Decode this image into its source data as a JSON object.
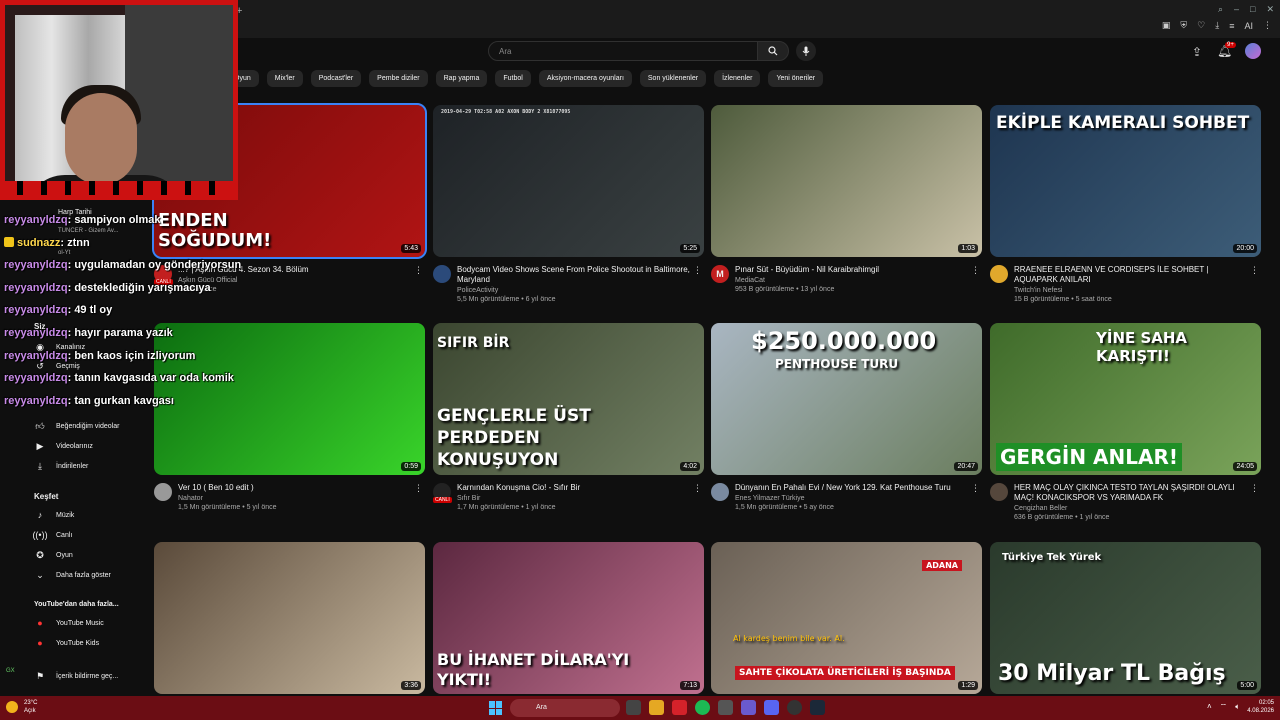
{
  "browser": {
    "new_tab": "+",
    "win_controls": [
      "–",
      "□",
      "✕"
    ],
    "tools": [
      "☰",
      "♡",
      "⭳",
      "☰"
    ],
    "ai_label": "AI"
  },
  "header": {
    "search_placeholder": "Ara",
    "notif_count": "9+"
  },
  "chips": [
    "Oyun",
    "Mix'ler",
    "Podcast'ler",
    "Pembe diziler",
    "Rap yapma",
    "Futbol",
    "Aksiyon-macera oyunları",
    "Son yüklenenler",
    "İzlenenler",
    "Yeni öneriler"
  ],
  "sidebar": {
    "subs": [
      {
        "label": "Harp Tarihi"
      },
      {
        "label": "TUNCER - Gizem Av..."
      },
      {
        "label": "ol-Yt"
      }
    ],
    "you_label": "Siz",
    "items_you": [
      {
        "label": "Kanalınız",
        "icon": "channel-icon"
      },
      {
        "label": "Geçmiş",
        "icon": "history-icon"
      }
    ],
    "items_lib": [
      {
        "label": "Beğendiğim videolar",
        "icon": "like-icon"
      },
      {
        "label": "Videolarınız",
        "icon": "video-icon"
      },
      {
        "label": "İndirilenler",
        "icon": "download-icon"
      }
    ],
    "explore_heading": "Keşfet",
    "explore": [
      {
        "label": "Müzik",
        "icon": "music-icon"
      },
      {
        "label": "Canlı",
        "icon": "live-icon"
      },
      {
        "label": "Oyun",
        "icon": "gaming-icon"
      },
      {
        "label": "Daha fazla göster",
        "icon": "chevron-down-icon"
      }
    ],
    "more_heading": "YouTube'dan daha fazla...",
    "more": [
      {
        "label": "YouTube Music"
      },
      {
        "label": "YouTube Kids"
      }
    ],
    "report": "İçerik bildirme geç...",
    "gx": "GX"
  },
  "chat": [
    {
      "user": "reyyanyldzq",
      "msg": ": sampiyon olmak",
      "badge": false
    },
    {
      "user": "sudnazz",
      "msg": ": ztnn",
      "badge": true
    },
    {
      "user": "reyyanyldzq",
      "msg": ": uygulamadan oy gönderiyorsun",
      "badge": false
    },
    {
      "user": "reyyanyldzq",
      "msg": ": desteklediğin yarışmacıya",
      "badge": false
    },
    {
      "user": "reyyanyldzq",
      "msg": ": 49 tl oy",
      "badge": false
    },
    {
      "user": "reyyanyldzq",
      "msg": ": hayır parama yazık",
      "badge": false
    },
    {
      "user": "reyyanyldzq",
      "msg": ": ben kaos için izliyorum",
      "badge": false
    },
    {
      "user": "reyyanyldzq",
      "msg": ": tanın kavgasıda var oda komik",
      "badge": false
    },
    {
      "user": "reyyanyldzq",
      "msg": ": tan gurkan kavgası",
      "badge": false
    }
  ],
  "videos": [
    {
      "title": "Aşkın Gücü 4. Sezon 34. Bölüm",
      "title_prefix": "...? | ",
      "channel": "Aşkın Gücü Official",
      "stats": "3 hafta önce",
      "duration": "5:43",
      "thumb_text": "ENDEN SOĞUDUM!",
      "live": "CANLI",
      "colors": [
        "#7a0b0b",
        "#b11414"
      ],
      "avatar": "#c21f1f"
    },
    {
      "title": "Bodycam Video Shows Scene From Police Shootout in Baltimore, Maryland",
      "channel": "PoliceActivity",
      "stats": "5,5 Mn görüntüleme • 6 yıl önce",
      "duration": "5:25",
      "thumb_text": "2019-04-29 T02:58 A02 AXON BODY 2 X81077095",
      "colors": [
        "#1e2226",
        "#3a4142"
      ],
      "avatar": "#2b4a7a"
    },
    {
      "title": "Pınar Süt - Büyüdüm - Nil Karaibrahimgil",
      "channel": "MediaCat",
      "stats": "953 B görüntüleme • 13 yıl önce",
      "duration": "1:03",
      "thumb_text": "",
      "colors": [
        "#4e5b3c",
        "#c9c1a7"
      ],
      "avatar": "#c21f1f",
      "avatar_letter": "M"
    },
    {
      "title": "RRAENEE ELRAENN VE CORDISEPS İLE SOHBET | AQUAPARK ANILARI",
      "channel": "Twitch'in Nefesi",
      "stats": "15 B görüntüleme • 5 saat önce",
      "duration": "20:00",
      "thumb_text": "EKİPLE KAMERALI SOHBET",
      "colors": [
        "#1e3550",
        "#3d5d78"
      ],
      "avatar": "#e0a82c"
    },
    {
      "title": "Ver 10 ( Ben 10 edit )",
      "channel": "Nahator",
      "stats": "1,5 Mn görüntüleme • 5 yıl önce",
      "duration": "0:59",
      "thumb_text": "",
      "colors": [
        "#0c6d10",
        "#39d42a"
      ],
      "avatar": "#999999"
    },
    {
      "title": "Karnından Konuşma Cio! - Sıfır Bir",
      "channel": "Sıfır Bir",
      "stats": "1,7 Mn görüntüleme • 1 yıl önce",
      "duration": "4:02",
      "thumb_text": "GENÇLERLE ÜST PERDEDEN KONUŞUYON",
      "thumb_text2": "SIFIR BİR",
      "live": "CANLI",
      "colors": [
        "#3b4630",
        "#728063"
      ],
      "avatar": "#222222"
    },
    {
      "title": "Dünyanın En Pahalı Evi / New York 129. Kat Penthouse Turu",
      "channel": "Enes Yilmazer Türkiye",
      "stats": "1,5 Mn görüntüleme • 5 ay önce",
      "duration": "20:47",
      "thumb_text": "$250.000.000",
      "thumb_text2": "PENTHOUSE TURU",
      "colors": [
        "#a9b6c2",
        "#6b7e5f"
      ],
      "avatar": "#7a8aa0"
    },
    {
      "title": "HER MAÇ OLAY ÇIKINCA TESTO TAYLAN ŞAŞIRDI! OLAYLI MAÇ! KONACIKSPOR VS YARIMADA FK",
      "channel": "Cengizhan Beller",
      "stats": "636 B görüntüleme • 1 yıl önce",
      "duration": "24:05",
      "thumb_text": "YİNE SAHA KARIŞTI!",
      "thumb_text2": "GERGİN ANLAR!",
      "colors": [
        "#3f6b2a",
        "#7aa35a"
      ],
      "avatar": "#55473c"
    },
    {
      "title": "",
      "channel": "",
      "stats": "",
      "duration": "3:36",
      "thumb_text": "",
      "colors": [
        "#5a4a3a",
        "#c9b9a0"
      ],
      "avatar": "#444"
    },
    {
      "title": "",
      "channel": "",
      "stats": "",
      "duration": "7:13",
      "thumb_text": "BU İHANET DİLARA'YI YIKTI!",
      "colors": [
        "#5c2840",
        "#c0708f"
      ],
      "avatar": "#444"
    },
    {
      "title": "",
      "channel": "",
      "stats": "",
      "duration": "1:29",
      "thumb_text": "SAHTE ÇİKOLATA ÜRETİCİLERİ İŞ BAŞINDA",
      "thumb_text2": "ADANA",
      "thumb_text3": "Al kardeş benim bile var. Al.",
      "colors": [
        "#6a6055",
        "#b6a898"
      ],
      "avatar": "#444"
    },
    {
      "title": "",
      "channel": "",
      "stats": "",
      "duration": "5:00",
      "thumb_text": "30 Milyar TL Bağış",
      "thumb_text2": "Türkiye Tek Yürek",
      "colors": [
        "#2a3a2c",
        "#4a5e49"
      ],
      "avatar": "#444"
    }
  ],
  "taskbar": {
    "temp": "23°C",
    "weather": "Açık",
    "search": "Ara",
    "time": "02:05",
    "date": "4.08.2026"
  }
}
